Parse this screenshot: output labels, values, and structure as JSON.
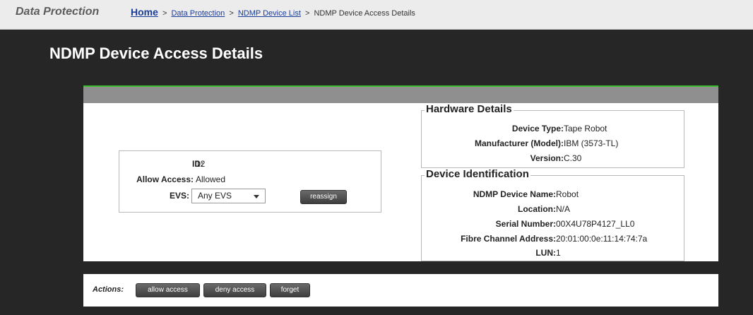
{
  "app": {
    "name": "Data Protection"
  },
  "breadcrumb": {
    "home": "Home",
    "separator": ">",
    "items": [
      "Data Protection",
      "NDMP Device List"
    ],
    "current": "NDMP Device Access Details"
  },
  "page": {
    "title": "NDMP Device Access Details"
  },
  "access": {
    "id_label": "ID:",
    "id_value": "12",
    "allow_label": "Allow Access:",
    "allow_value": "Allowed",
    "evs_label": "EVS:",
    "evs_selected": "Any EVS",
    "reassign_button": "reassign"
  },
  "hardware": {
    "legend": "Hardware Details",
    "device_type_label": "Device Type:",
    "device_type_value": "Tape Robot",
    "manufacturer_label": "Manufacturer (Model):",
    "manufacturer_value": "IBM (3573-TL)",
    "version_label": "Version:",
    "version_value": "C.30"
  },
  "identification": {
    "legend": "Device Identification",
    "name_label": "NDMP Device Name:",
    "name_value": "Robot",
    "location_label": "Location:",
    "location_value": "N/A",
    "serial_label": "Serial Number:",
    "serial_value": "00X4U78P4127_LL0",
    "fc_label": "Fibre Channel Address:",
    "fc_value": "20:01:00:0e:11:14:74:7a",
    "lun_label": "LUN:",
    "lun_value": "1"
  },
  "actions": {
    "label": "Actions:",
    "allow_access": "allow access",
    "deny_access": "deny access",
    "forget": "forget"
  },
  "colors": {
    "accent_green": "#3cbf2e",
    "background_dark": "#262626",
    "header_gray": "#8f8f8f",
    "link_blue": "#1a3d99"
  }
}
